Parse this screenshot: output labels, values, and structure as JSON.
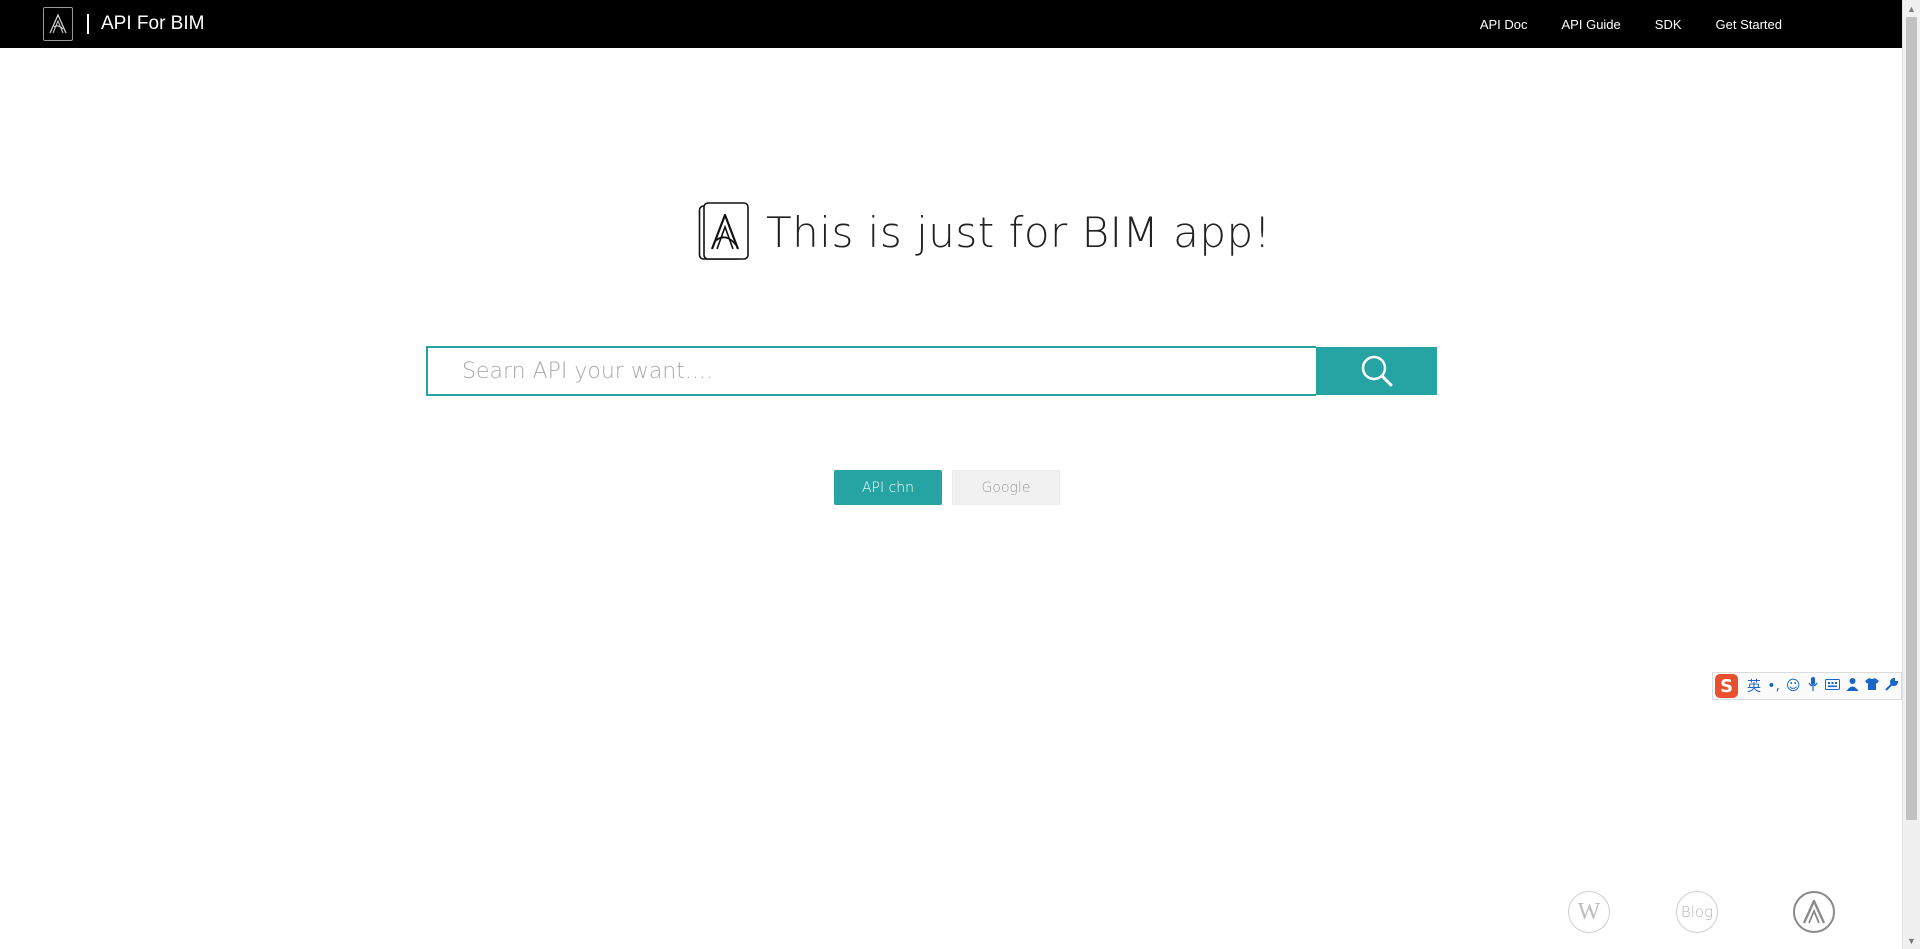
{
  "header": {
    "brand_title": "API For BIM",
    "logo_icon": "autodesk-a-icon",
    "nav": [
      {
        "label": "API Doc"
      },
      {
        "label": "API Guide"
      },
      {
        "label": "SDK"
      },
      {
        "label": "Get Started"
      }
    ]
  },
  "hero": {
    "title": "This is just for BIM app!",
    "logo_icon": "autodesk-a-icon"
  },
  "search": {
    "placeholder": "Searn API your want....",
    "value": "",
    "button_icon": "search-icon"
  },
  "engines": {
    "primary_label": "API chn",
    "secondary_label": "Google",
    "selected": "API chn"
  },
  "ime": {
    "logo": "S",
    "mode": "英",
    "punct": "•,",
    "icons": [
      "emoji-icon",
      "microphone-icon",
      "keyboard-icon",
      "user-icon",
      "skin-icon",
      "settings-wrench-icon"
    ]
  },
  "footer_links": {
    "w_label": "W",
    "blog_label": "Blog",
    "a_icon": "autodesk-a-icon"
  },
  "colors": {
    "nav_bg": "#000000",
    "accent": "#26a3a3",
    "ime_red": "#e8502e",
    "ime_blue": "#1a66c6"
  }
}
